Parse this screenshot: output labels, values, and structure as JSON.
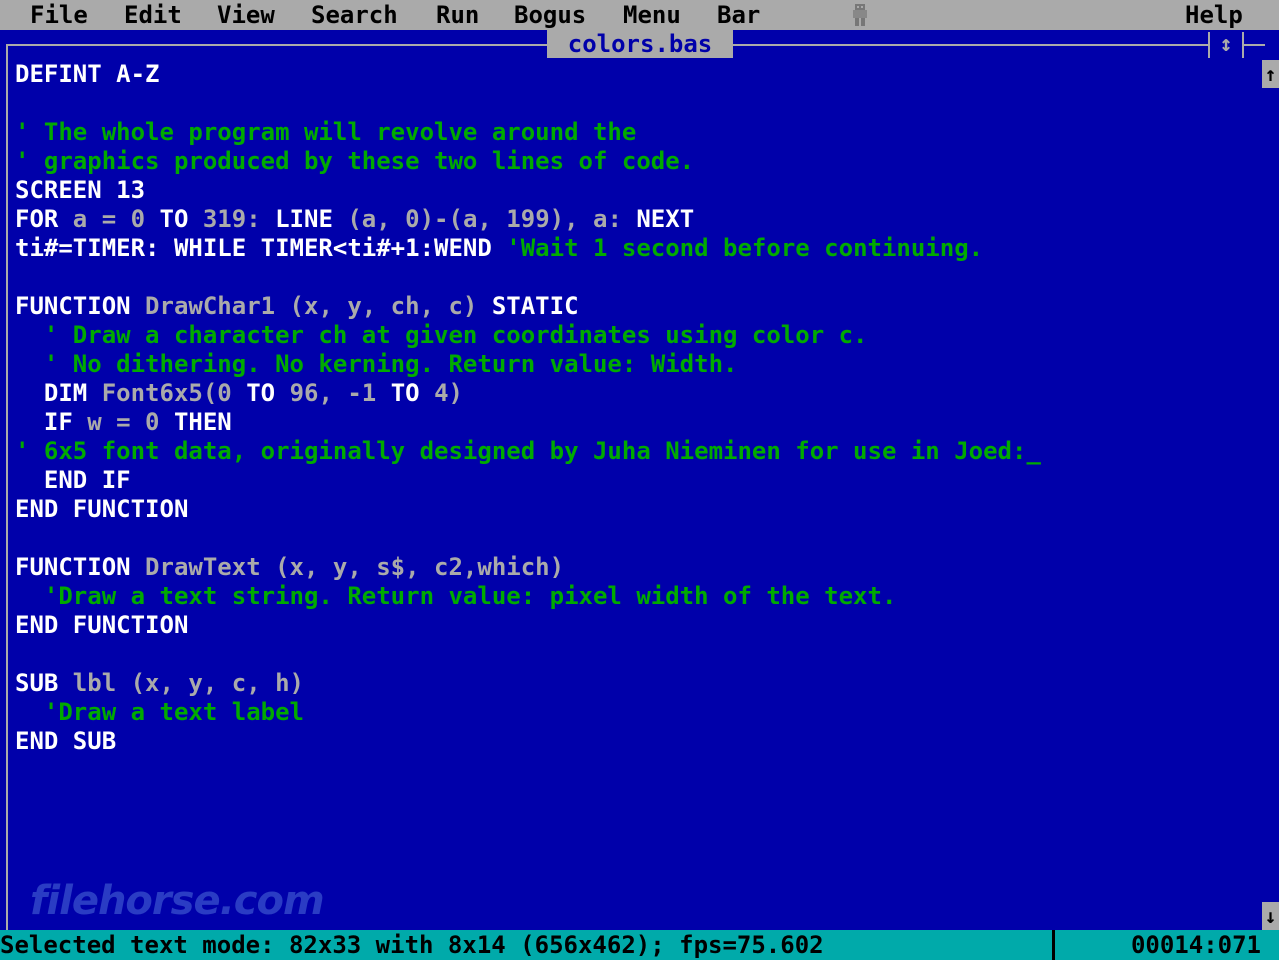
{
  "menubar": {
    "items": [
      "File",
      "Edit",
      "View",
      "Search",
      "Run",
      "Bogus",
      "Menu",
      "Bar"
    ],
    "help": "Help"
  },
  "editor": {
    "file_title": "colors.bas",
    "maximize_glyph": "↕",
    "scroll_up_glyph": "↑",
    "scroll_down_glyph": "↓"
  },
  "code": {
    "l1": "DEFINT A-Z",
    "l3": "' The whole program will revolve around the",
    "l4": "' graphics produced by these two lines of code.",
    "l5a": "SCREEN 13",
    "l6a": "FOR ",
    "l6b": "a = 0 ",
    "l6c": "TO ",
    "l6d": "319: ",
    "l6e": "LINE ",
    "l6f": "(a, 0)-(a, 199), a: ",
    "l6g": "NEXT",
    "l7a": "ti#=TIMER: WHILE TIMER<ti#+1:WEND ",
    "l7b": "'Wait 1 second before continuing.",
    "l9a": "FUNCTION ",
    "l9b": "DrawChar1 (x, y, ch, c) ",
    "l9c": "STATIC",
    "l10": "  ' Draw a character ch at given coordinates using color c.",
    "l11": "  ' No dithering. No kerning. Return value: Width.",
    "l12a": "  DIM ",
    "l12b": "Font6x5(0 ",
    "l12c": "TO ",
    "l12d": "96, -1 ",
    "l12e": "TO ",
    "l12f": "4)",
    "l13a": "  IF ",
    "l13b": "w = 0 ",
    "l13c": "THEN",
    "l14": "' 6x5 font data, originally designed by Juha Nieminen for use in Joed:",
    "l14cursor": "_",
    "l15": "  END IF",
    "l16": "END FUNCTION",
    "l18a": "FUNCTION ",
    "l18b": "DrawText (x, y, s$, c2,which)",
    "l19": "  'Draw a text string. Return value: pixel width of the text.",
    "l20": "END FUNCTION",
    "l22a": "SUB ",
    "l22b": "lbl (x, y, c, h)",
    "l23": "  'Draw a text label",
    "l24": "END SUB"
  },
  "watermark": "filehorse.com",
  "status": {
    "text": "Selected text mode: 82x33 with 8x14 (656x462); fps=75.602",
    "position": "00014:071"
  },
  "colors": {
    "background": "#0000aa",
    "menubar": "#aaaaaa",
    "keyword": "#ffffff",
    "identifier": "#aaaaaa",
    "comment": "#00aa00",
    "statusbar": "#00aaaa"
  }
}
